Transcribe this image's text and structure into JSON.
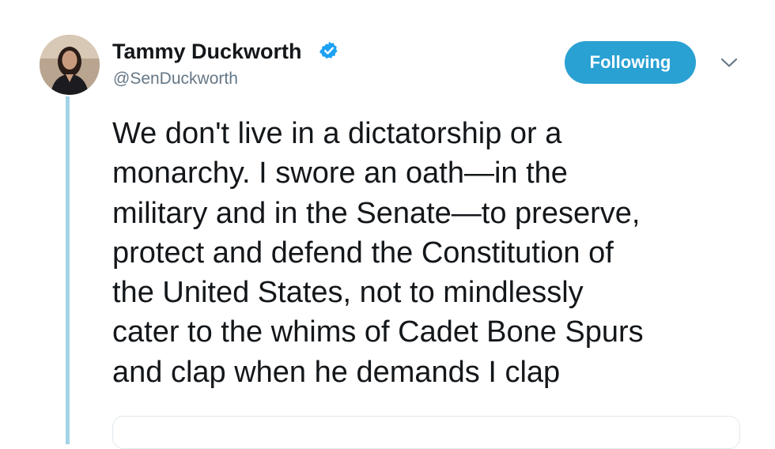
{
  "tweet": {
    "author": {
      "display_name": "Tammy Duckworth",
      "handle": "@SenDuckworth",
      "verified": true,
      "avatar_icon": "profile-photo"
    },
    "follow_button_label": "Following",
    "menu_icon": "chevron-down-icon",
    "text_lines": [
      "We don't live in a dictatorship or a",
      "monarchy. I swore an oath—in the",
      "military and in the Senate—to preserve,",
      "protect and defend the Constitution of",
      "the United States, not to mindlessly",
      "cater to the whims of Cadet Bone Spurs",
      "and clap when he demands I clap"
    ]
  },
  "colors": {
    "accent": "#2aa1d3",
    "verified_badge": "#1da1f2",
    "thread_line": "#a2d3e6",
    "handle_text": "#657786",
    "body_text": "#14171a"
  }
}
